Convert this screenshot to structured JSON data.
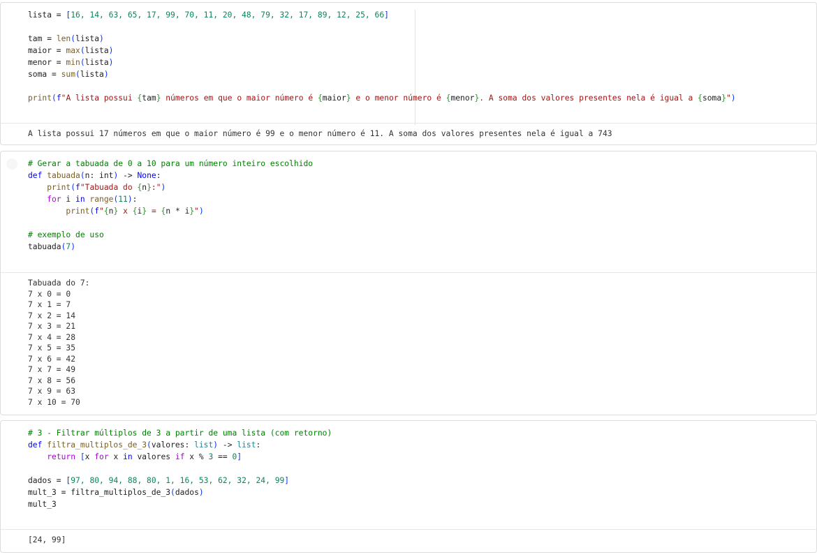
{
  "cells": [
    {
      "code": [
        [
          [
            "lista = ",
            "p"
          ],
          [
            "[",
            "b"
          ],
          [
            "16, 14, 63, 65, 17, 99, 70, 11, 20, 48, 79, 32, 17, 89, 12, 25, 66",
            "n"
          ],
          [
            "]",
            "b"
          ]
        ],
        [],
        [
          [
            "tam = ",
            "p"
          ],
          [
            "len",
            "f"
          ],
          [
            "(",
            "b"
          ],
          [
            "lista",
            "p"
          ],
          [
            ")",
            "b"
          ]
        ],
        [
          [
            "maior = ",
            "p"
          ],
          [
            "max",
            "f"
          ],
          [
            "(",
            "b"
          ],
          [
            "lista",
            "p"
          ],
          [
            ")",
            "b"
          ]
        ],
        [
          [
            "menor = ",
            "p"
          ],
          [
            "min",
            "f"
          ],
          [
            "(",
            "b"
          ],
          [
            "lista",
            "p"
          ],
          [
            ")",
            "b"
          ]
        ],
        [
          [
            "soma = ",
            "p"
          ],
          [
            "sum",
            "f"
          ],
          [
            "(",
            "b"
          ],
          [
            "lista",
            "p"
          ],
          [
            ")",
            "b"
          ]
        ],
        [],
        [
          [
            "print",
            "f"
          ],
          [
            "(",
            "b"
          ],
          [
            "f",
            "k"
          ],
          [
            "\"A lista possui ",
            "s"
          ],
          [
            "{",
            "g"
          ],
          [
            "tam",
            "p"
          ],
          [
            "}",
            "g"
          ],
          [
            " números em que o maior número é ",
            "s"
          ],
          [
            "{",
            "g"
          ],
          [
            "maior",
            "p"
          ],
          [
            "}",
            "g"
          ],
          [
            " e o menor número é ",
            "s"
          ],
          [
            "{",
            "g"
          ],
          [
            "menor",
            "p"
          ],
          [
            "}",
            "g"
          ],
          [
            ". A soma dos valores presentes nela é igual a ",
            "s"
          ],
          [
            "{",
            "g"
          ],
          [
            "soma",
            "p"
          ],
          [
            "}",
            "g"
          ],
          [
            "\"",
            "s"
          ],
          [
            ")",
            "b"
          ]
        ]
      ],
      "output": [
        "A lista possui 17 números em que o maior número é 99 e o menor número é 11. A soma dos valores presentes nela é igual a 743"
      ]
    },
    {
      "code": [
        [
          [
            "# Gerar a tabuada de 0 a 10 para um número inteiro escolhido",
            "cm"
          ]
        ],
        [
          [
            "def ",
            "k"
          ],
          [
            "tabuada",
            "f"
          ],
          [
            "(",
            "b"
          ],
          [
            "n: int",
            "p"
          ],
          [
            ")",
            "b"
          ],
          [
            " -> ",
            "p"
          ],
          [
            "None",
            "k"
          ],
          [
            ":",
            "p"
          ]
        ],
        [
          [
            "    print",
            "f"
          ],
          [
            "(",
            "b"
          ],
          [
            "f",
            "k"
          ],
          [
            "\"Tabuada do ",
            "s"
          ],
          [
            "{",
            "g"
          ],
          [
            "n",
            "p"
          ],
          [
            "}",
            "g"
          ],
          [
            ":\"",
            "s"
          ],
          [
            ")",
            "b"
          ]
        ],
        [
          [
            "    for",
            "c"
          ],
          [
            " i ",
            "p"
          ],
          [
            "in",
            "k"
          ],
          [
            " range",
            "f"
          ],
          [
            "(",
            "b"
          ],
          [
            "11",
            "n"
          ],
          [
            ")",
            "b"
          ],
          [
            ":",
            "p"
          ]
        ],
        [
          [
            "        print",
            "f"
          ],
          [
            "(",
            "b"
          ],
          [
            "f",
            "k"
          ],
          [
            "\"",
            "s"
          ],
          [
            "{",
            "g"
          ],
          [
            "n",
            "p"
          ],
          [
            "}",
            "g"
          ],
          [
            " x ",
            "s"
          ],
          [
            "{",
            "g"
          ],
          [
            "i",
            "p"
          ],
          [
            "}",
            "g"
          ],
          [
            " = ",
            "s"
          ],
          [
            "{",
            "g"
          ],
          [
            "n * i",
            "p"
          ],
          [
            "}",
            "g"
          ],
          [
            "\"",
            "s"
          ],
          [
            ")",
            "b"
          ]
        ],
        [],
        [
          [
            "# exemplo de uso",
            "cm"
          ]
        ],
        [
          [
            "tabuada",
            "p"
          ],
          [
            "(",
            "b"
          ],
          [
            "7",
            "n"
          ],
          [
            ")",
            "b"
          ]
        ]
      ],
      "output": [
        "Tabuada do 7:",
        "7 x 0 = 0",
        "7 x 1 = 7",
        "7 x 2 = 14",
        "7 x 3 = 21",
        "7 x 4 = 28",
        "7 x 5 = 35",
        "7 x 6 = 42",
        "7 x 7 = 49",
        "7 x 8 = 56",
        "7 x 9 = 63",
        "7 x 10 = 70"
      ]
    },
    {
      "code": [
        [
          [
            "# 3 - Filtrar múltiplos de 3 a partir de uma lista (com retorno)",
            "cm"
          ]
        ],
        [
          [
            "def ",
            "k"
          ],
          [
            "filtra_multiplos_de_3",
            "f"
          ],
          [
            "(",
            "b"
          ],
          [
            "valores: ",
            "p"
          ],
          [
            "list",
            "t"
          ],
          [
            ")",
            "b"
          ],
          [
            " -> ",
            "p"
          ],
          [
            "list",
            "t"
          ],
          [
            ":",
            "p"
          ]
        ],
        [
          [
            "    return ",
            "c"
          ],
          [
            "[",
            "b"
          ],
          [
            "x ",
            "p"
          ],
          [
            "for",
            "c"
          ],
          [
            " x ",
            "p"
          ],
          [
            "in",
            "k"
          ],
          [
            " valores ",
            "p"
          ],
          [
            "if",
            "c"
          ],
          [
            " x % ",
            "p"
          ],
          [
            "3",
            "n"
          ],
          [
            " == ",
            "p"
          ],
          [
            "0",
            "n"
          ],
          [
            "]",
            "b"
          ]
        ],
        [],
        [
          [
            "dados = ",
            "p"
          ],
          [
            "[",
            "b"
          ],
          [
            "97, 80, 94, 88, 80, 1, 16, 53, 62, 32, 24, 99",
            "n"
          ],
          [
            "]",
            "b"
          ]
        ],
        [
          [
            "mult_3 = filtra_multiplos_de_3",
            "p"
          ],
          [
            "(",
            "b"
          ],
          [
            "dados",
            "p"
          ],
          [
            ")",
            "b"
          ]
        ],
        [
          [
            "mult_3",
            "p"
          ]
        ]
      ],
      "output": [
        "[24, 99]"
      ]
    }
  ]
}
